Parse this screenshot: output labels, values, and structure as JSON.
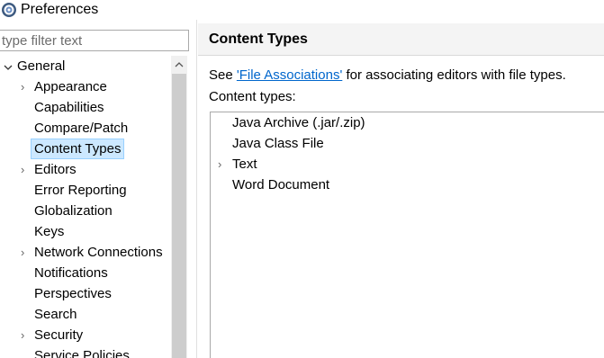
{
  "window": {
    "title": "Preferences",
    "icon": "preferences-gear-icon"
  },
  "filter": {
    "placeholder": "type filter text",
    "value": ""
  },
  "tree": {
    "root": {
      "label": "General",
      "expanded": true
    },
    "children": [
      {
        "label": "Appearance",
        "expandable": true
      },
      {
        "label": "Capabilities",
        "expandable": false
      },
      {
        "label": "Compare/Patch",
        "expandable": false
      },
      {
        "label": "Content Types",
        "expandable": false,
        "selected": true
      },
      {
        "label": "Editors",
        "expandable": true
      },
      {
        "label": "Error Reporting",
        "expandable": false
      },
      {
        "label": "Globalization",
        "expandable": false
      },
      {
        "label": "Keys",
        "expandable": false
      },
      {
        "label": "Network Connections",
        "expandable": true
      },
      {
        "label": "Notifications",
        "expandable": false
      },
      {
        "label": "Perspectives",
        "expandable": false
      },
      {
        "label": "Search",
        "expandable": false
      },
      {
        "label": "Security",
        "expandable": true
      },
      {
        "label": "Service Policies",
        "expandable": false
      }
    ]
  },
  "page": {
    "title": "Content Types",
    "desc_prefix": "See ",
    "desc_link": "'File Associations'",
    "desc_suffix": " for associating editors with file types.",
    "types_label": "Content types:"
  },
  "content_types": [
    {
      "label": "Java Archive (.jar/.zip)",
      "expandable": false
    },
    {
      "label": "Java Class File",
      "expandable": false
    },
    {
      "label": "Text",
      "expandable": true
    },
    {
      "label": "Word Document",
      "expandable": false
    }
  ],
  "colors": {
    "selection_bg": "#cce8ff",
    "selection_border": "#99d1ff",
    "link": "#0066cc",
    "header_bg": "#f4f4f4"
  }
}
